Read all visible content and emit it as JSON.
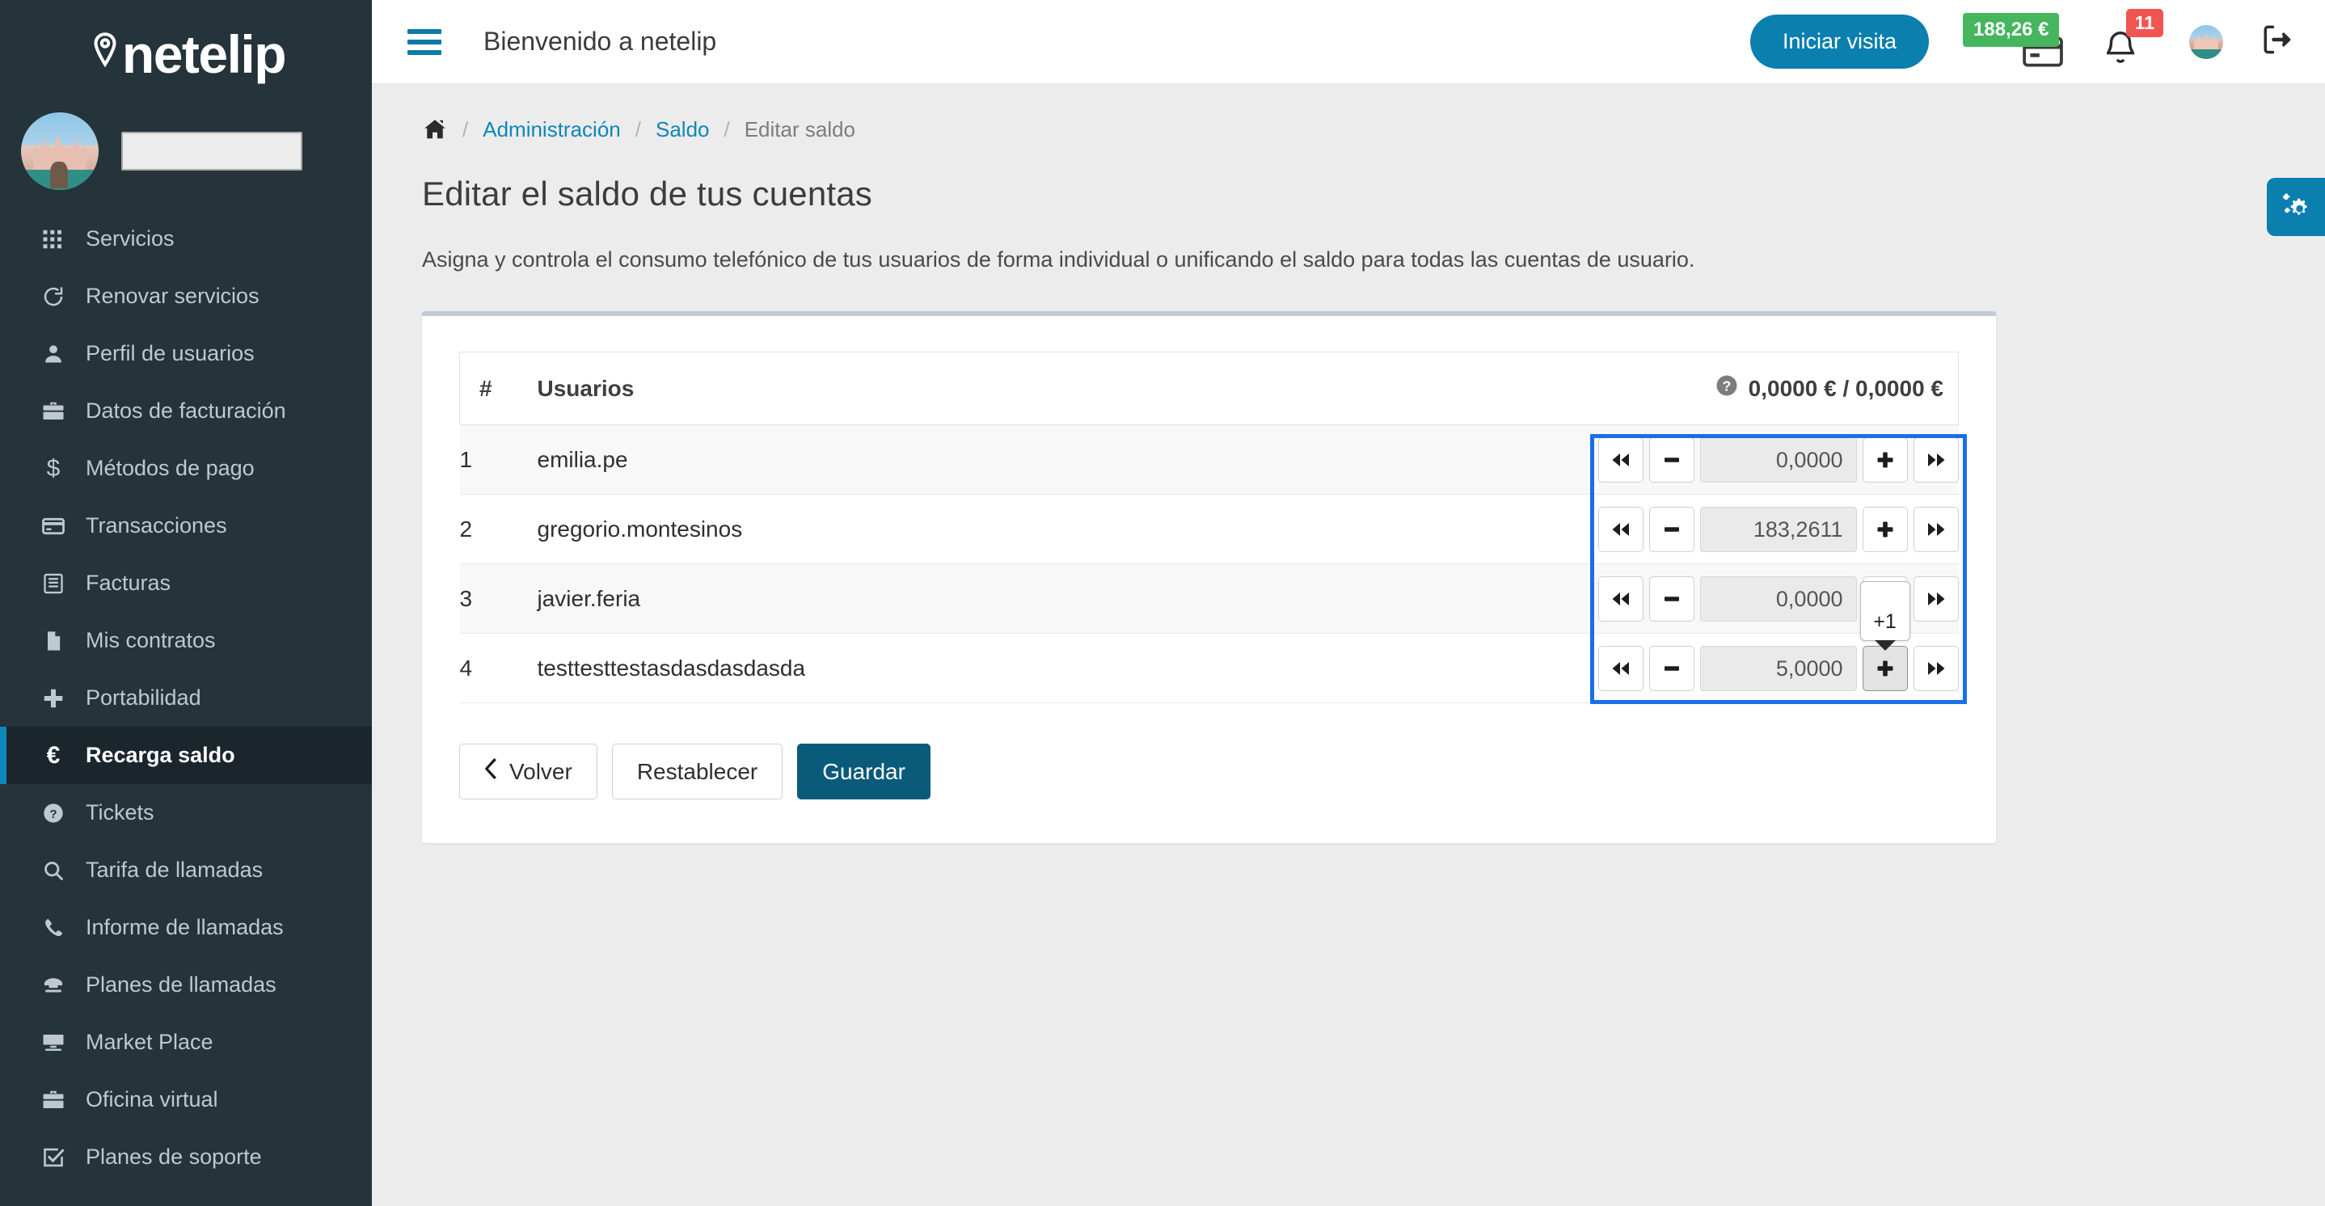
{
  "brand": {
    "name": "netelip",
    "pin_icon": "location-pin-icon"
  },
  "sidebar": {
    "search_placeholder": "",
    "search_value": "",
    "avatar_alt": "user-avatar",
    "items": [
      {
        "label": "Servicios",
        "icon": "grid-icon",
        "active": false
      },
      {
        "label": "Renovar servicios",
        "icon": "refresh-icon",
        "active": false
      },
      {
        "label": "Perfil de usuarios",
        "icon": "user-icon",
        "active": false
      },
      {
        "label": "Datos de facturación",
        "icon": "briefcase-icon",
        "active": false
      },
      {
        "label": "Métodos de pago",
        "icon": "dollar-icon",
        "active": false
      },
      {
        "label": "Transacciones",
        "icon": "credit-card-icon",
        "active": false
      },
      {
        "label": "Facturas",
        "icon": "invoice-list-icon",
        "active": false
      },
      {
        "label": "Mis contratos",
        "icon": "document-icon",
        "active": false
      },
      {
        "label": "Portabilidad",
        "icon": "plus-icon",
        "active": false
      },
      {
        "label": "Recarga saldo",
        "icon": "euro-icon",
        "active": true
      },
      {
        "label": "Tickets",
        "icon": "question-circle-icon",
        "active": false
      },
      {
        "label": "Tarifa de llamadas",
        "icon": "search-icon",
        "active": false
      },
      {
        "label": "Informe de llamadas",
        "icon": "phone-icon",
        "active": false
      },
      {
        "label": "Planes de llamadas",
        "icon": "telephone-icon",
        "active": false
      },
      {
        "label": "Market Place",
        "icon": "desktop-icon",
        "active": false
      },
      {
        "label": "Oficina virtual",
        "icon": "suitcase-icon",
        "active": false
      },
      {
        "label": "Planes de soporte",
        "icon": "check-square-icon",
        "active": false
      }
    ]
  },
  "topbar": {
    "menu_toggle_icon": "hamburger-icon",
    "title": "Bienvenido a netelip",
    "visit_button": "Iniciar visita",
    "balance_badge": "188,26 €",
    "balance_icon": "credit-card-icon",
    "notifications_count": "11",
    "notifications_icon": "bell-icon",
    "avatar_alt": "user-avatar",
    "logout_icon": "logout-icon",
    "settings_tab_icon": "cogs-icon",
    "accent_blue": "#0b7fae",
    "badge_green": "#45b55e",
    "badge_red": "#f0564f"
  },
  "breadcrumb": {
    "home_icon": "home-icon",
    "separator": "/",
    "items": [
      {
        "label": "Administración",
        "link": true
      },
      {
        "label": "Saldo",
        "link": true
      },
      {
        "label": "Editar saldo",
        "link": false
      }
    ]
  },
  "page": {
    "title": "Editar el saldo de tus cuentas",
    "subtitle": "Asigna y controla el consumo telefónico de tus usuarios de forma individual o unificando el saldo para todas las cuentas de usuario."
  },
  "table": {
    "headers": {
      "index": "#",
      "user": "Usuarios",
      "total": "0,0000 € / 0,0000 €",
      "total_help_icon": "question-circle-icon"
    },
    "rows": [
      {
        "index": "1",
        "user": "emilia.pe",
        "value": "0,0000"
      },
      {
        "index": "2",
        "user": "gregorio.montesinos",
        "value": "183,2611"
      },
      {
        "index": "3",
        "user": "javier.feria",
        "value": "0,0000"
      },
      {
        "index": "4",
        "user": "testtesttestasdasdasdasda",
        "value": "5,0000"
      }
    ],
    "spinner": {
      "fast_backward_icon": "fast-backward-icon",
      "minus_icon": "minus-icon",
      "plus_icon": "plus-icon",
      "fast_forward_icon": "fast-forward-icon"
    },
    "tooltip": {
      "text": "+1",
      "attached_to_row": "4"
    },
    "highlight_color": "#1a6fe8"
  },
  "actions": {
    "back": "Volver",
    "back_icon": "chevron-left-icon",
    "reset": "Restablecer",
    "save": "Guardar"
  }
}
